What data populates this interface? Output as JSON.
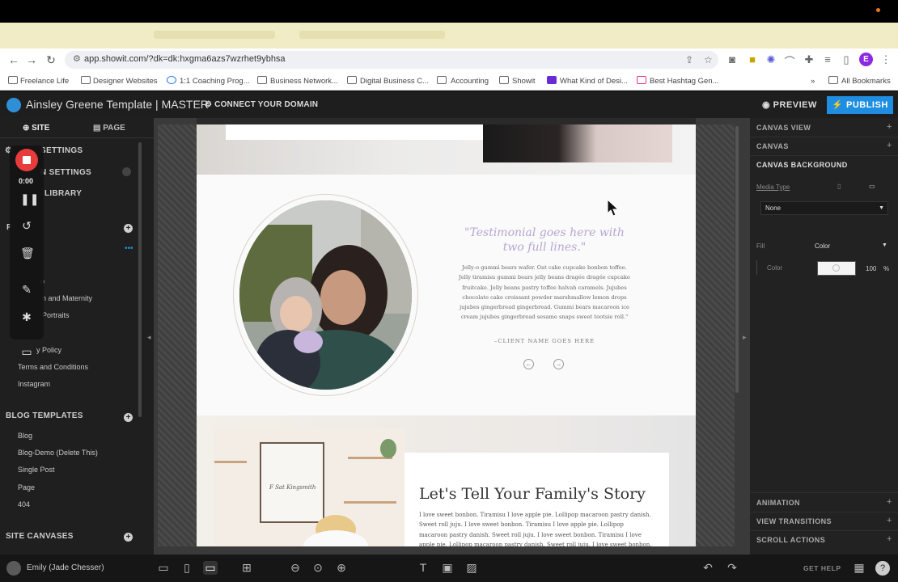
{
  "browser": {
    "url": "app.showit.com/?dk=dk:hxgma6azs7wzrhet9ybhsa",
    "profile_initial": "E",
    "bookmarks": [
      "Freelance Life",
      "Designer Websites",
      "1:1 Coaching Prog...",
      "Business Network...",
      "Digital Business C...",
      "Accounting",
      "Showit",
      "What Kind of Desi...",
      "Best Hashtag Gen..."
    ],
    "all_bookmarks": "All Bookmarks",
    "more": "»"
  },
  "app": {
    "title": "Ainsley Greene Template | MASTER",
    "connect_domain": "CONNECT YOUR DOMAIN",
    "preview": "PREVIEW",
    "publish": "PUBLISH"
  },
  "left_panel": {
    "tabs": [
      "SITE",
      "PAGE"
    ],
    "settings_items": [
      "SETTINGS",
      "N SETTINGS",
      "LIBRARY"
    ],
    "pages_header": "P",
    "pages": [
      "o",
      "n and Maternity",
      "Portraits",
      "y Policy",
      "Terms and Conditions",
      "Instagram"
    ],
    "blog_templates_header": "BLOG TEMPLATES",
    "blog_templates": [
      "Blog",
      "Blog-Demo (Delete This)",
      "Single Post",
      "Page",
      "404"
    ],
    "site_canvases_header": "SITE CANVASES"
  },
  "recorder": {
    "time": "0:00"
  },
  "canvas": {
    "testimonial_title": "\"Testimonial goes here with two full lines.\"",
    "testimonial_body": "Jelly-o gummi bears wafer. Oat cake cupcake bonbon toffee. Jelly tiramisu gummi bears jelly beans dragée dragée cupcake fruitcake. Jelly beans pastry toffee halvah caramels. Jujubes chocolate cake croissant powder marshmallow lemon drops jujubes gingerbread gingerbread. Gummi bears macaroon ice cream jujubes gingerbread sesame snaps sweet tootsie roll.\"",
    "client_name": "–CLIENT NAME GOES HERE",
    "prev_arrow": "←",
    "next_arrow": "→",
    "section_heading": "Let's Tell Your Family's Story",
    "section_body": "I love sweet bonbon. Tiramisu I love apple pie. Lollipop macaroon pastry danish. Sweet roll juju. I love sweet bonbon. Tiramisu I love apple pie. Lollipop macaroon pastry danish. Sweet roll juju. I love sweet bonbon. Tiramisu I love apple pie. Lollipop macaroon pastry danish. Sweet roll juju. I love sweet bonbon. Tiramisu I"
  },
  "right_panel": {
    "sections_top": [
      "CANVAS VIEW",
      "CANVAS",
      "CANVAS BACKGROUND"
    ],
    "media_type_label": "Media Type",
    "media_type_value": "None",
    "fill_label": "Fill",
    "fill_value": "Color",
    "color_label": "Color",
    "opacity": "100",
    "opacity_unit": "%",
    "sections_bottom": [
      "ANIMATION",
      "VIEW TRANSITIONS",
      "SCROLL ACTIONS"
    ]
  },
  "footer": {
    "user": "Emily (Jade Chesser)",
    "get_help": "GET HELP"
  },
  "colors": {
    "accent": "#1f8ee0",
    "record": "#e83b3b",
    "testimonial_title": "#b6a6d0"
  }
}
